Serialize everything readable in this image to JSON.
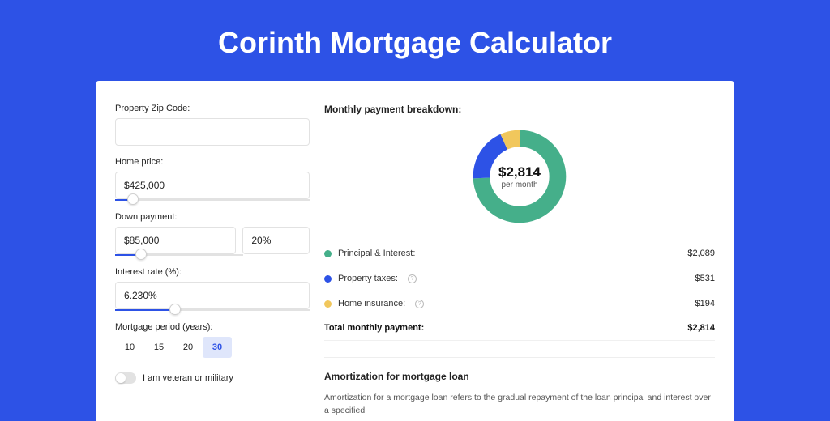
{
  "page_title": "Corinth Mortgage Calculator",
  "form": {
    "zip_label": "Property Zip Code:",
    "zip_value": "",
    "home_price_label": "Home price:",
    "home_price_value": "$425,000",
    "home_price_slider_pct": 9,
    "down_payment_label": "Down payment:",
    "down_payment_value": "$85,000",
    "down_payment_pct_value": "20%",
    "down_payment_slider_pct": 20,
    "interest_label": "Interest rate (%):",
    "interest_value": "6.230%",
    "interest_slider_pct": 31,
    "period_label": "Mortgage period (years):",
    "periods": [
      "10",
      "15",
      "20",
      "30"
    ],
    "period_active_index": 3,
    "veteran_label": "I am veteran or military",
    "veteran_on": false
  },
  "breakdown": {
    "title": "Monthly payment breakdown:",
    "center_amount": "$2,814",
    "center_sub": "per month",
    "items": [
      {
        "label": "Principal & Interest:",
        "value": "$2,089",
        "color": "#45af8a",
        "info": false,
        "pct": 74.2
      },
      {
        "label": "Property taxes:",
        "value": "$531",
        "color": "#2d52e6",
        "info": true,
        "pct": 18.9
      },
      {
        "label": "Home insurance:",
        "value": "$194",
        "color": "#f1c75c",
        "info": true,
        "pct": 6.9
      }
    ],
    "total_label": "Total monthly payment:",
    "total_value": "$2,814"
  },
  "amort": {
    "title": "Amortization for mortgage loan",
    "text": "Amortization for a mortgage loan refers to the gradual repayment of the loan principal and interest over a specified"
  },
  "chart_data": {
    "type": "pie",
    "title": "Monthly payment breakdown",
    "series": [
      {
        "name": "Principal & Interest",
        "value": 2089,
        "pct": 74.2,
        "color": "#45af8a"
      },
      {
        "name": "Property taxes",
        "value": 531,
        "pct": 18.9,
        "color": "#2d52e6"
      },
      {
        "name": "Home insurance",
        "value": 194,
        "pct": 6.9,
        "color": "#f1c75c"
      }
    ],
    "total": 2814,
    "center_label": "$2,814 per month"
  }
}
